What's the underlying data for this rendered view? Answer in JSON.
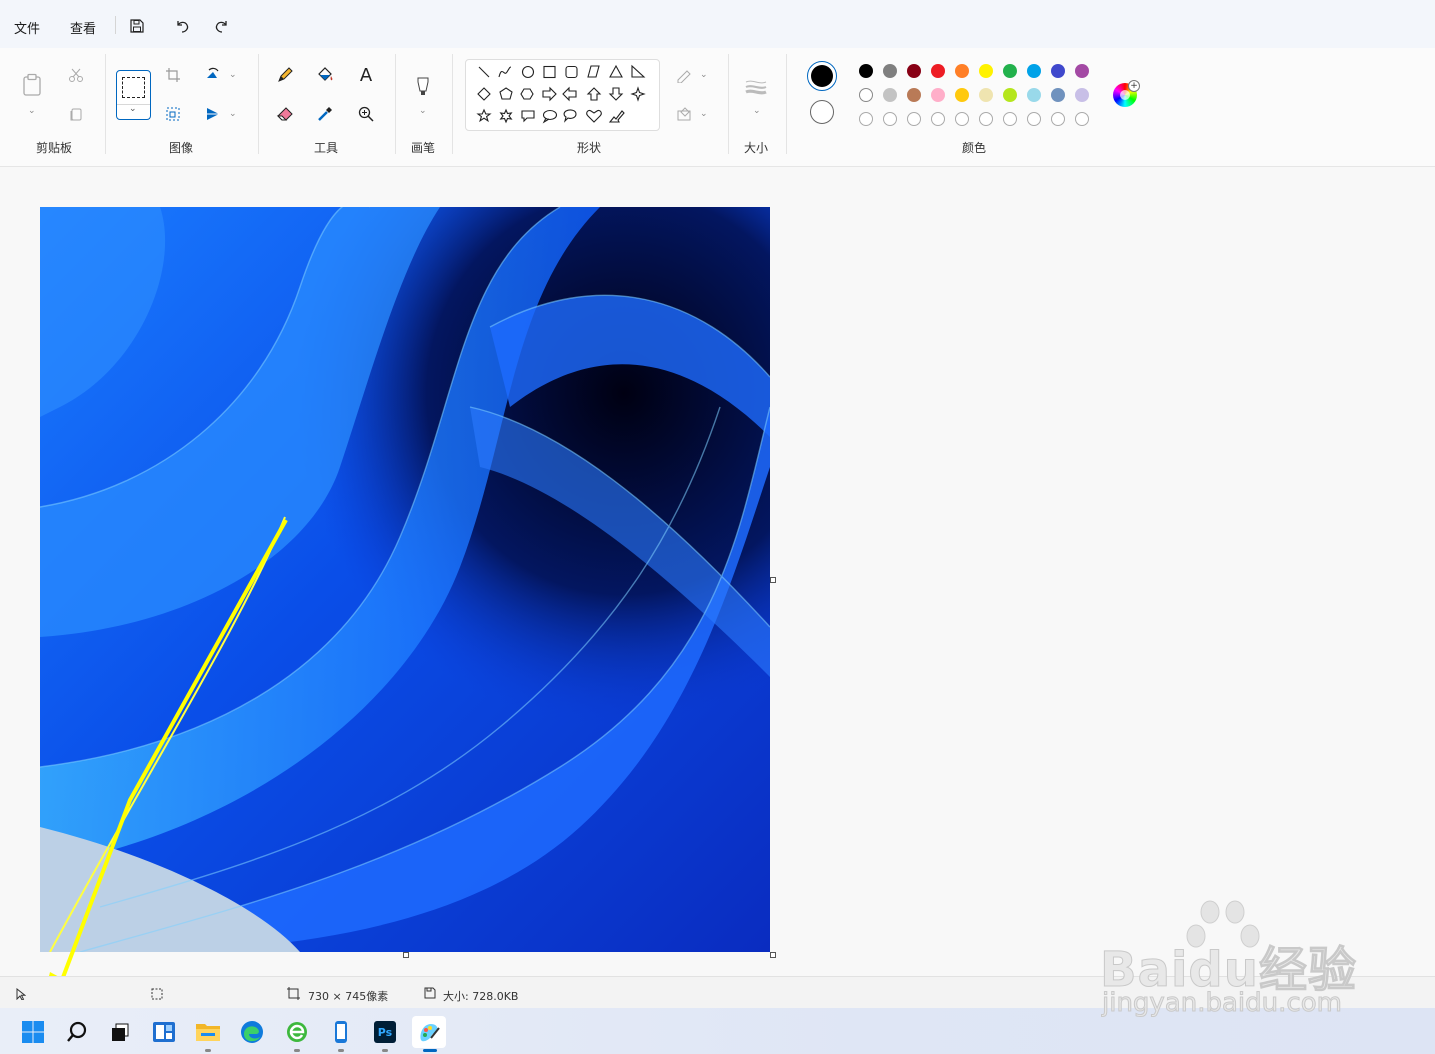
{
  "menu": {
    "file": "文件",
    "view": "查看"
  },
  "groups": {
    "clipboard": "剪贴板",
    "image": "图像",
    "tools": "工具",
    "brushes": "画笔",
    "shapes": "形状",
    "size": "大小",
    "colors": "颜色"
  },
  "tools": {
    "text_glyph": "A"
  },
  "colors": {
    "primary": "#000000",
    "secondary": "#ffffff",
    "palette_row1": [
      "#000000",
      "#7f7f7f",
      "#880015",
      "#ed1c24",
      "#ff7f27",
      "#fff200",
      "#22b14c",
      "#00a2e8",
      "#3f48cc",
      "#a349a4"
    ],
    "palette_row2": [
      "#ffffff",
      "#c3c3c3",
      "#b97a57",
      "#ffaec9",
      "#ffc90e",
      "#efe4b0",
      "#b5e61d",
      "#99d9ea",
      "#7092be",
      "#c8bfe7"
    ]
  },
  "status": {
    "dimensions": "730 × 745像素",
    "filesize": "大小: 728.0KB"
  },
  "taskbar": {
    "ps_label": "Ps"
  },
  "watermark": {
    "brand": "Baidu经验",
    "url": "jingyan.baidu.com"
  }
}
